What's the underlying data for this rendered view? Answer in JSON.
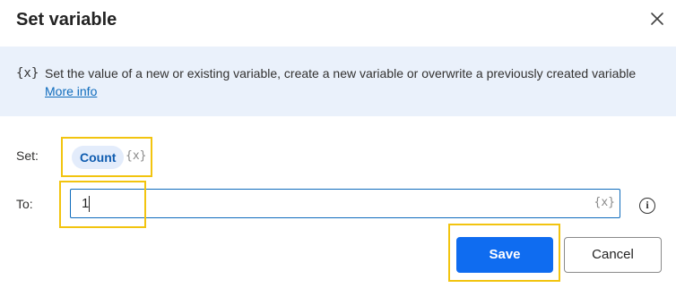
{
  "dialog": {
    "title": "Set variable",
    "close_icon": "close-icon"
  },
  "info": {
    "icon_text": "{x}",
    "text": "Set the value of a new or existing variable, create a new variable or overwrite a previously created variable",
    "link_text": "More info"
  },
  "form": {
    "set_label": "Set:",
    "variable_name": "Count",
    "variable_icon_text": "{x}",
    "to_label": "To:",
    "to_value": "1",
    "to_icon_text": "{x}",
    "help_icon_text": "i"
  },
  "buttons": {
    "save_label": "Save",
    "cancel_label": "Cancel"
  },
  "colors": {
    "primary": "#0f6cf0",
    "info_bg": "#eaf1fb",
    "highlight": "#f2c40f",
    "link": "#0f6cbd"
  }
}
